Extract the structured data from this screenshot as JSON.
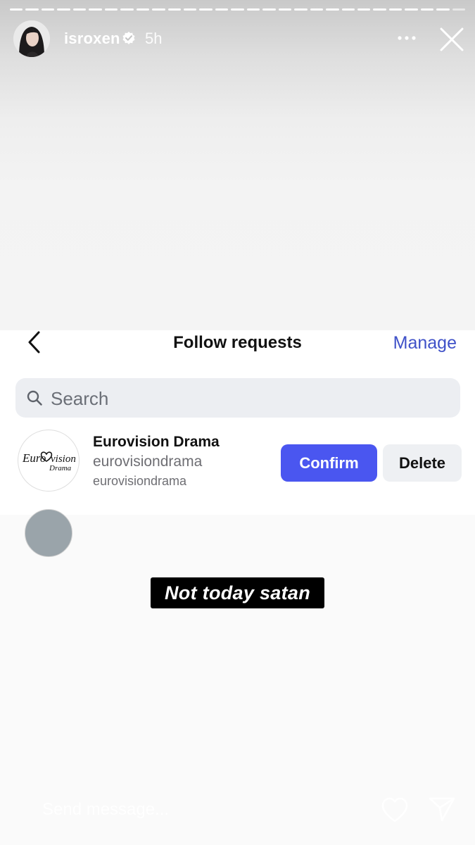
{
  "story": {
    "username": "isroxen",
    "time": "5h",
    "progress_segments": 29,
    "seen_segments": 28
  },
  "panel": {
    "title": "Follow requests",
    "manage_label": "Manage",
    "search_placeholder": "Search",
    "requests": [
      {
        "name": "Eurovision Drama",
        "username": "eurovisiondrama",
        "subtitle": "eurovisiondrama",
        "confirm_label": "Confirm",
        "delete_label": "Delete",
        "avatar_text_1": "Euro",
        "avatar_text_2": "vision",
        "avatar_text_3": "Drama"
      }
    ]
  },
  "sticker": {
    "text": "Not today satan"
  },
  "footer": {
    "send_placeholder": "Send message..."
  },
  "colors": {
    "accent": "#4a56f0",
    "manage": "#3f51c8",
    "sticker_bg": "#000000"
  }
}
